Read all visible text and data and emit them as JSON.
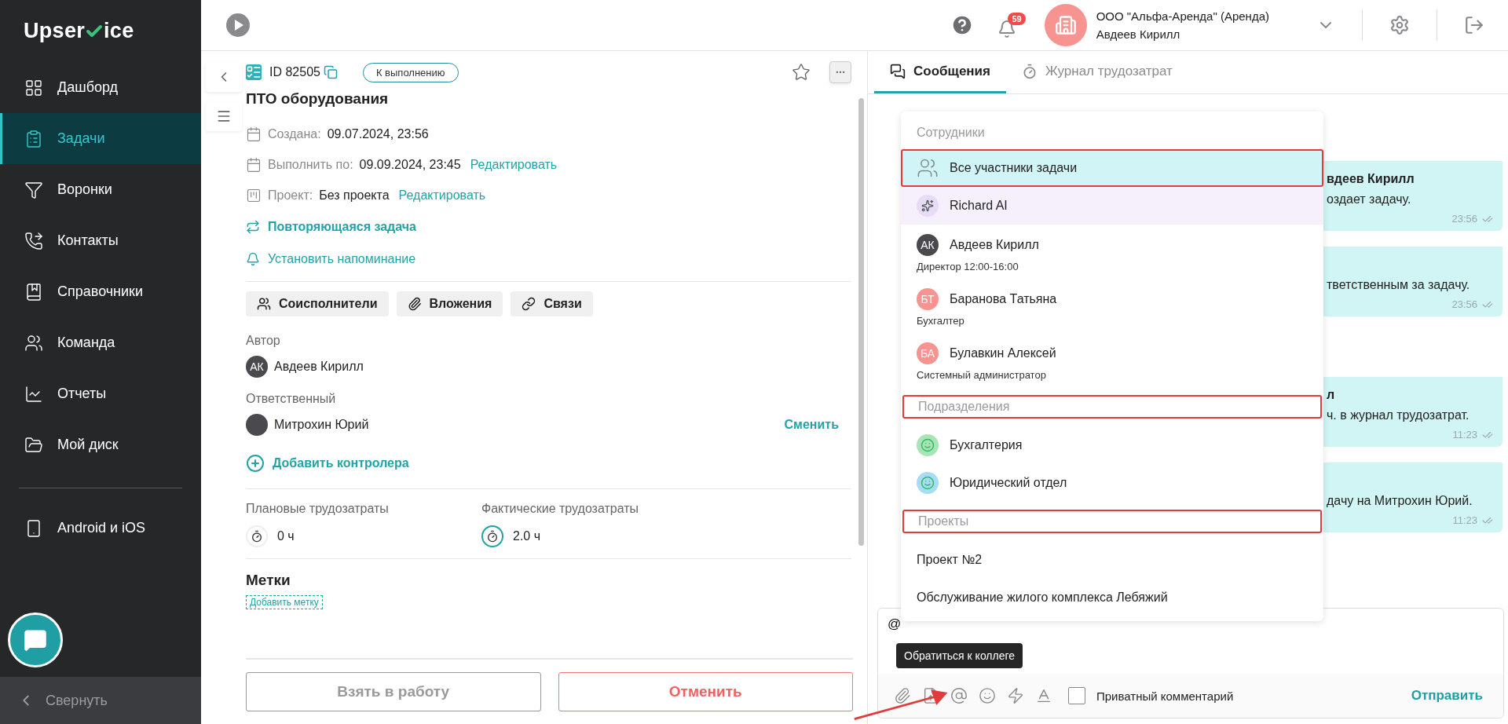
{
  "sidebar": {
    "logo_start": "Upser",
    "logo_end": "ice",
    "items": [
      {
        "label": "Дашборд",
        "selected": false
      },
      {
        "label": "Задачи",
        "selected": true
      },
      {
        "label": "Воронки",
        "selected": false
      },
      {
        "label": "Контакты",
        "selected": false
      },
      {
        "label": "Справочники",
        "selected": false
      },
      {
        "label": "Команда",
        "selected": false
      },
      {
        "label": "Отчеты",
        "selected": false
      },
      {
        "label": "Мой диск",
        "selected": false
      }
    ],
    "apps": "Android и iOS",
    "collapse": "Свернуть"
  },
  "header": {
    "notifications": "59",
    "company": "ООО \"Альфа-Аренда\" (Аренда)",
    "user": "Авдеев Кирилл"
  },
  "task": {
    "id": "ID 82505",
    "status": "К выполнению",
    "starred": false,
    "title": "ПТО оборудования",
    "fields": [
      {
        "label": "Создана:",
        "value": "09.07.2024, 23:56"
      },
      {
        "label": "Выполнить по:",
        "value": "09.09.2024, 23:45",
        "action": "Редактировать"
      },
      {
        "label": "Проект:",
        "value": "Без проекта",
        "action": "Редактировать",
        "kind": "project"
      }
    ],
    "links": [
      {
        "kind": "repeat",
        "label": "Повторяющаяся задача"
      },
      {
        "kind": "reminder",
        "label": "Установить напоминание"
      }
    ],
    "sections": [
      "Соисполнители",
      "Вложения",
      "Связи"
    ],
    "author": {
      "heading": "Автор",
      "initials": "АК",
      "name": "Авдеев Кирилл"
    },
    "responsible": {
      "heading": "Ответственный",
      "name": "Митрохин Юрий",
      "action": "Сменить"
    },
    "add_controller": "Добавить контролера",
    "effort": [
      {
        "label": "Плановые трудозатраты",
        "value": "0 ч",
        "active": false
      },
      {
        "label": "Фактические трудозатраты",
        "value": "2.0 ч",
        "active": true
      }
    ],
    "tags": {
      "heading": "Метки",
      "add": "Добавить метку"
    },
    "actions": [
      {
        "label": "Взять в работу",
        "kind": "neutral"
      },
      {
        "label": "Отменить",
        "kind": "danger"
      }
    ]
  },
  "chat": {
    "tabs": [
      {
        "label": "Сообщения",
        "selected": true
      },
      {
        "label": "Журнал трудозатрат",
        "selected": false
      }
    ],
    "messages": [
      {
        "author": "вдеев Кирилл",
        "text": "оздает задачу.",
        "time": "23:56"
      },
      {
        "text": "тветственным за задачу.",
        "time": "23:56"
      },
      {
        "author": "л",
        "text": "ч. в журнал трудозатрат.",
        "time": "11:23"
      },
      {
        "text": "дачу на Митрохин Юрий.",
        "time": "11:23"
      }
    ],
    "mention_menu": [
      {
        "title": "Сотрудники",
        "highlighted": false,
        "items": [
          {
            "kind": "group",
            "name": "Все участники задачи",
            "selected": true,
            "highlighted": true
          },
          {
            "kind": "ai",
            "name": "Richard AI",
            "selected": false,
            "highlighted": false
          },
          {
            "kind": "person",
            "initials": "АК",
            "name": "Авдеев Кирилл",
            "role": "Директор 12:00-16:00",
            "color": "#4a4a4e",
            "selected": false,
            "highlighted": false
          },
          {
            "kind": "person",
            "initials": "БТ",
            "name": "Баранова Татьяна",
            "role": "Бухгалтер",
            "color": "#f7948f",
            "selected": false,
            "highlighted": false
          },
          {
            "kind": "person",
            "initials": "БА",
            "name": "Булавкин Алексей",
            "role": "Системный администратор",
            "color": "#f7948f",
            "selected": false,
            "highlighted": false
          }
        ]
      },
      {
        "title": "Подразделения",
        "highlighted": true,
        "items": [
          {
            "kind": "department",
            "name": "Бухгалтерия",
            "color": "#a9e4b6",
            "selected": false,
            "highlighted": false
          },
          {
            "kind": "department",
            "name": "Юридический отдел",
            "color": "#a8dcf5",
            "selected": false,
            "highlighted": false
          }
        ]
      },
      {
        "title": "Проекты",
        "highlighted": true,
        "items": [
          {
            "kind": "project",
            "name": "Проект №2",
            "selected": false,
            "highlighted": false
          },
          {
            "kind": "project",
            "name": "Обслуживание жилого комплекса Лебяжий",
            "selected": false,
            "highlighted": false
          }
        ]
      }
    ],
    "composer": {
      "value": "@",
      "tooltip": "Обратиться к коллеге",
      "private_label": "Приватный комментарий",
      "private_checked": false,
      "send": "Отправить"
    }
  }
}
